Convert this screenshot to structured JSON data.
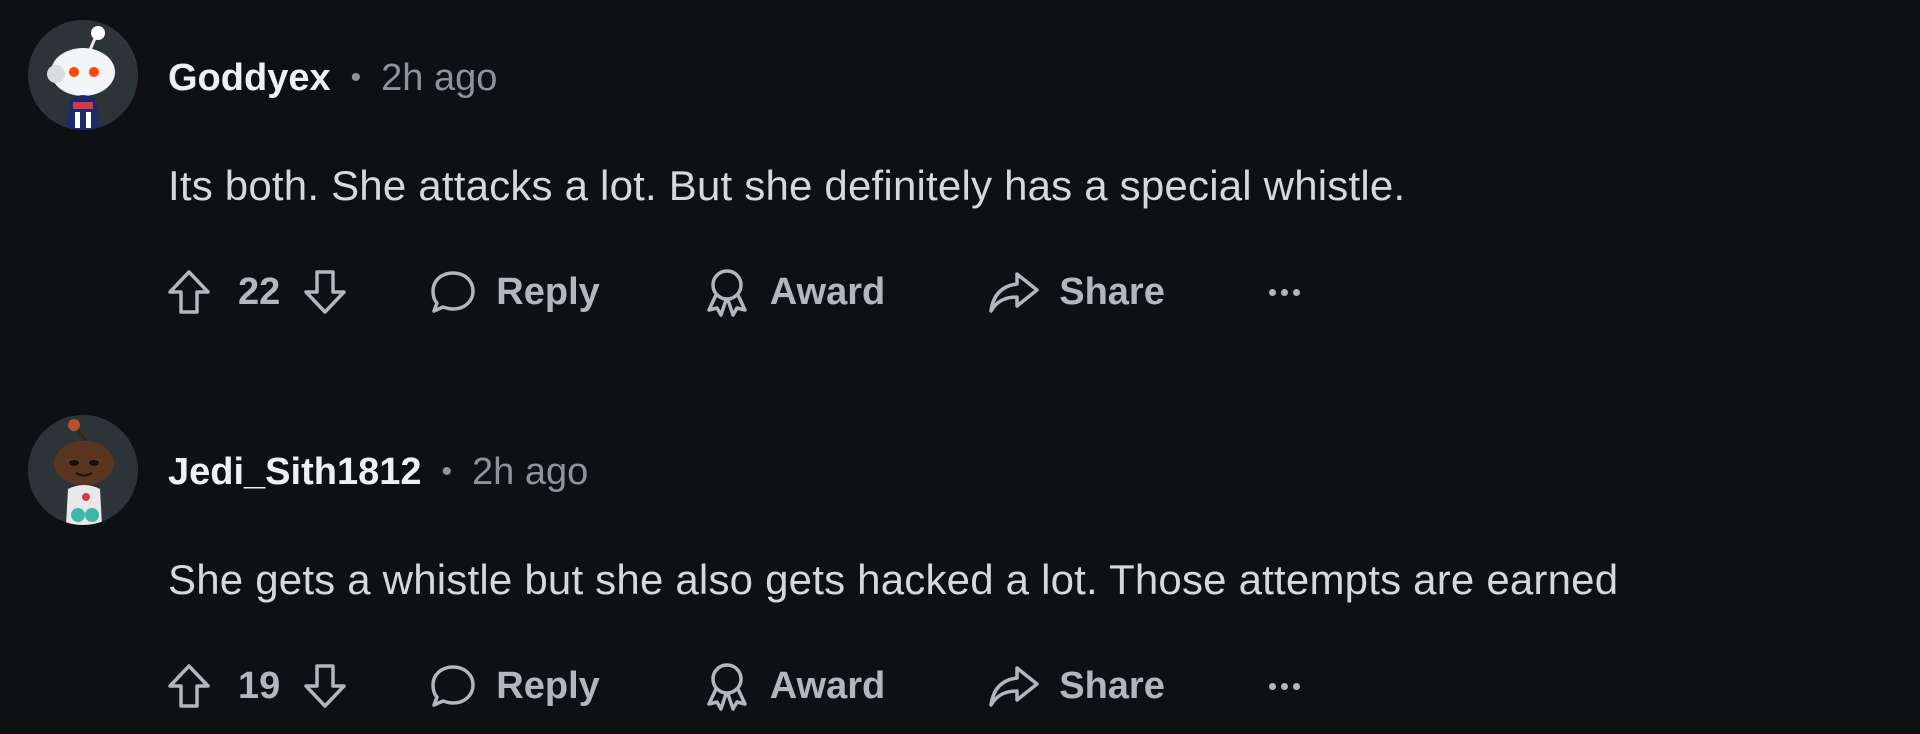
{
  "colors": {
    "background": "#0e1113",
    "username": "#eef1f3",
    "body_text": "#d4d9dd",
    "muted": "#8a949b",
    "action": "#b0b8be"
  },
  "comments": [
    {
      "avatar_icon": "snoo-astronaut-avatar",
      "username": "Goddyex",
      "separator": "•",
      "time": "2h ago",
      "text": "Its both. She attacks a lot. But she definitely has a special whistle.",
      "votes": "22",
      "upvote_icon": "upvote-arrow-icon",
      "downvote_icon": "downvote-arrow-icon",
      "reply_label": "Reply",
      "award_label": "Award",
      "share_label": "Share",
      "more_icon": "ellipsis-icon"
    },
    {
      "avatar_icon": "snoo-dark-skin-avatar",
      "username": "Jedi_Sith1812",
      "separator": "•",
      "time": "2h ago",
      "text": "She gets a whistle but she also gets hacked a lot. Those attempts are earned",
      "votes": "19",
      "upvote_icon": "upvote-arrow-icon",
      "downvote_icon": "downvote-arrow-icon",
      "reply_label": "Reply",
      "award_label": "Award",
      "share_label": "Share",
      "more_icon": "ellipsis-icon"
    }
  ]
}
